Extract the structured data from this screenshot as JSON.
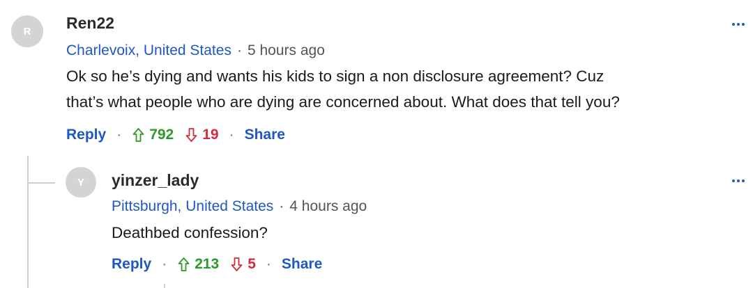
{
  "comments": [
    {
      "avatar_initial": "R",
      "author": "Ren22",
      "location": "Charlevoix, United States",
      "separator": "·",
      "time": "5 hours ago",
      "body_lines": [
        "Ok so he’s dying and wants his kids to sign a non disclosure agreement? Cuz",
        "that’s what people who are dying are concerned about. What does that tell you?"
      ],
      "reply_label": "Reply",
      "upvotes": "792",
      "downvotes": "19",
      "share_label": "Share"
    },
    {
      "avatar_initial": "Y",
      "author": "yinzer_lady",
      "location": "Pittsburgh, United States",
      "separator": "·",
      "time": "4 hours ago",
      "body_lines": [
        "Deathbed confession?"
      ],
      "reply_label": "Reply",
      "upvotes": "213",
      "downvotes": "5",
      "share_label": "Share"
    }
  ],
  "action_separator": "·",
  "colors": {
    "link": "#1f57c3",
    "upvote": "#2a9a2a",
    "downvote": "#d42a3c",
    "avatar_bg": "#d4d4d4",
    "thread_line": "#cfcfcf"
  },
  "icons": {
    "upvote": "arrow-up-outline-icon",
    "downvote": "arrow-down-outline-icon",
    "more": "more-horizontal-icon"
  }
}
